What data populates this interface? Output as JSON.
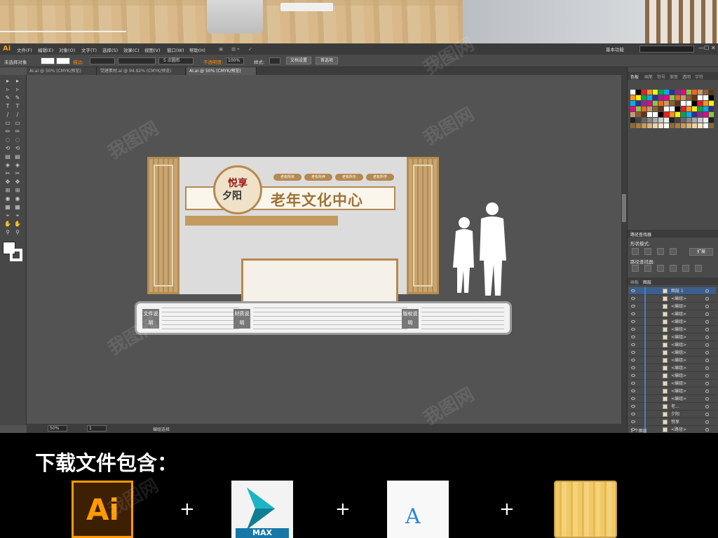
{
  "menubar": {
    "logo": "Ai",
    "items": [
      "文件(F)",
      "编辑(E)",
      "对象(O)",
      "文字(T)",
      "选择(S)",
      "效果(C)",
      "视图(V)",
      "窗口(W)",
      "帮助(H)"
    ],
    "workspace": "基本功能",
    "window_controls": [
      "—",
      "☐",
      "✕"
    ]
  },
  "controlbar": {
    "selection": "未选择对象",
    "stroke_label": "描边:",
    "stroke_value": "5 点圆形",
    "opacity_label": "不透明度:",
    "opacity_value": "100%",
    "style_label": "样式:",
    "doc_setup": "文档设置",
    "preferences": "首选项"
  },
  "tabs": [
    "AI.ai @ 50% (CMYK/预览)",
    "党建素材.ai @ 94.92% (CMYK/预览)",
    "AI.ai @ 50% (CMYK/预览)"
  ],
  "statusbar": {
    "zoom": "50%",
    "page": "1",
    "tool": "编组选择"
  },
  "artwork": {
    "seal_line1": "悦享",
    "seal_line2": "夕阳",
    "title": "老年文化中心",
    "pills": [
      "老有所依",
      "老有所养",
      "老有所乐",
      "老有所学"
    ],
    "base_labels": [
      "文件说明",
      "材质说明",
      "版权说明"
    ]
  },
  "panels": {
    "swatch_tabs": [
      "色板",
      "画笔",
      "符号",
      "渐变",
      "透明",
      "字符"
    ],
    "pathfinder_title": "路径查找器",
    "shape_modes": "形状模式:",
    "expand": "扩展",
    "pathfinder_label": "路径查找器:",
    "layers_tabs": [
      "画板",
      "图层"
    ],
    "layers": [
      {
        "name": "图层 1",
        "selected": true
      },
      {
        "name": "<编组>"
      },
      {
        "name": "<编组>"
      },
      {
        "name": "<编组>"
      },
      {
        "name": "<编组>"
      },
      {
        "name": "<编组>"
      },
      {
        "name": "<编组>"
      },
      {
        "name": "<编组>"
      },
      {
        "name": "<编组>"
      },
      {
        "name": "<编组>"
      },
      {
        "name": "<编组>"
      },
      {
        "name": "<编组>"
      },
      {
        "name": "<编组>"
      },
      {
        "name": "<编组>"
      },
      {
        "name": "<编组>"
      },
      {
        "name": "老..."
      },
      {
        "name": "夕阳"
      },
      {
        "name": "悦享"
      },
      {
        "name": "<路径>"
      },
      {
        "name": "<路径>"
      }
    ],
    "layers_footer": "1 个图层"
  },
  "footer": {
    "title": "下载文件包含：",
    "ai_icon_label": "Ai",
    "max_icon_label": "MAX",
    "font_icon_label": "A",
    "plus": "+"
  },
  "colors": {
    "accent_orange": "#ff9a00",
    "gold": "#b5894f",
    "selected_row": "#3c5f8d"
  }
}
